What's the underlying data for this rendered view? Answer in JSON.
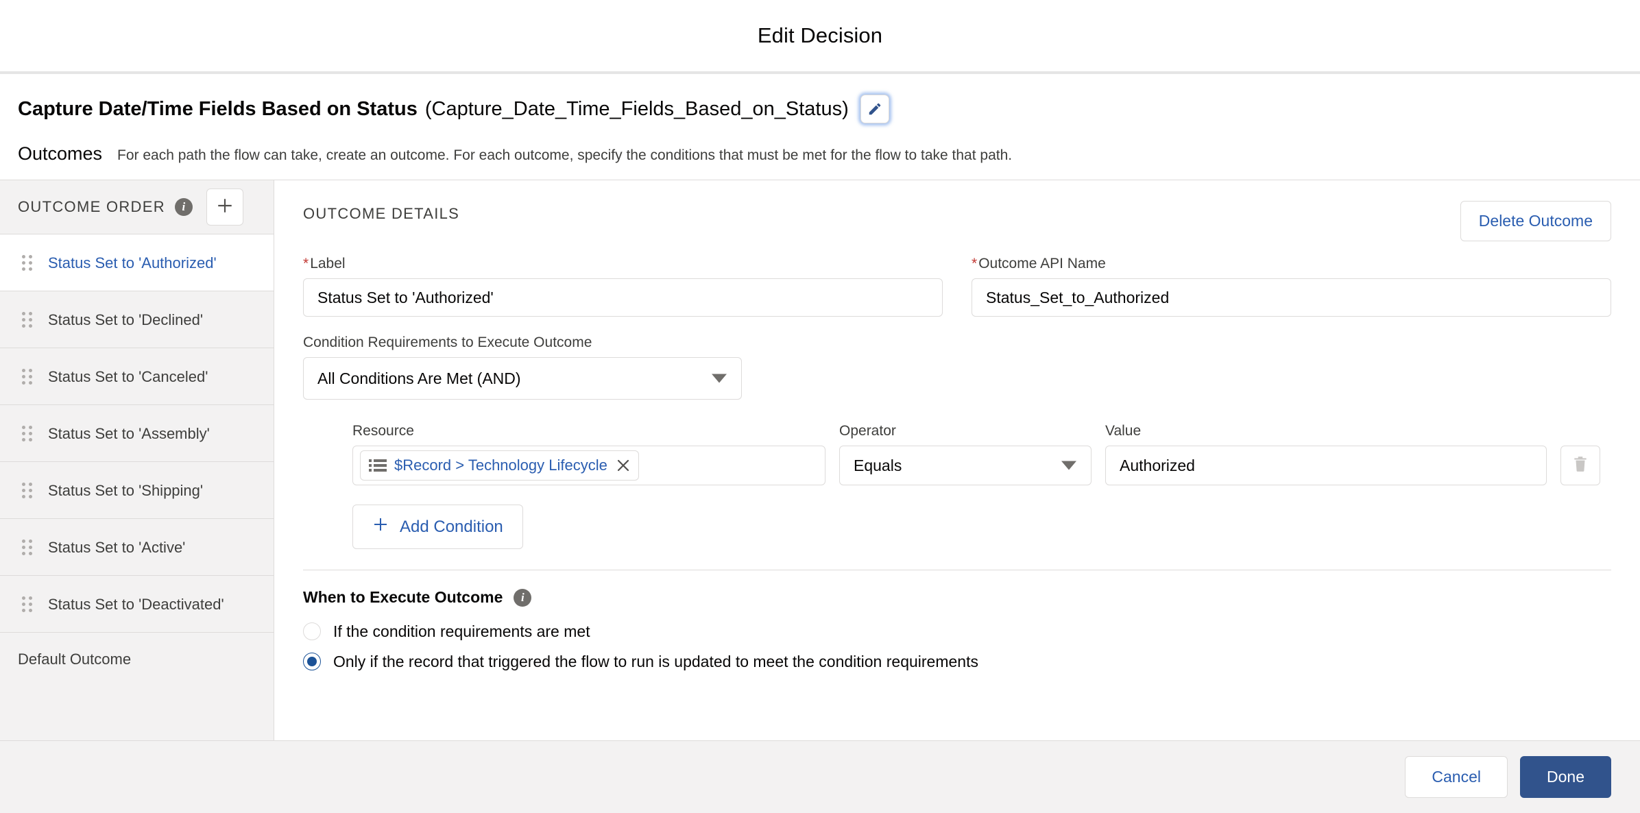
{
  "modal": {
    "title": "Edit Decision"
  },
  "element": {
    "label": "Capture Date/Time Fields Based on Status",
    "api_name": "(Capture_Date_Time_Fields_Based_on_Status)",
    "edit_icon": "pencil-icon"
  },
  "outcomes_intro": {
    "heading": "Outcomes",
    "description": "For each path the flow can take, create an outcome. For each outcome, specify the conditions that must be met for the flow to take that path."
  },
  "sidebar": {
    "header_title": "OUTCOME ORDER",
    "info_icon": "info-icon",
    "add_icon": "plus-icon",
    "items": [
      {
        "label": "Status Set to 'Authorized'",
        "selected": true
      },
      {
        "label": "Status Set to 'Declined'",
        "selected": false
      },
      {
        "label": "Status Set to 'Canceled'",
        "selected": false
      },
      {
        "label": "Status Set to 'Assembly'",
        "selected": false
      },
      {
        "label": "Status Set to 'Shipping'",
        "selected": false
      },
      {
        "label": "Status Set to 'Active'",
        "selected": false
      },
      {
        "label": "Status Set to 'Deactivated'",
        "selected": false
      }
    ],
    "default_outcome": "Default Outcome"
  },
  "details": {
    "heading": "OUTCOME DETAILS",
    "delete_outcome_label": "Delete Outcome",
    "label_field": {
      "label": "Label",
      "required_marker": "*",
      "value": "Status Set to 'Authorized'"
    },
    "api_name_field": {
      "label": "Outcome API Name",
      "required_marker": "*",
      "value": "Status_Set_to_Authorized"
    },
    "condition_requirements": {
      "label": "Condition Requirements to Execute Outcome",
      "value": "All Conditions Are Met (AND)",
      "caret_icon": "chevron-down-icon"
    },
    "condition_headers": {
      "resource": "Resource",
      "operator": "Operator",
      "value": "Value"
    },
    "condition_row": {
      "resource_icon": "list-icon",
      "resource_pill": "$Record > Technology Lifecycle",
      "resource_remove_icon": "close-icon",
      "operator": "Equals",
      "operator_caret_icon": "chevron-down-icon",
      "value": "Authorized",
      "delete_icon": "trash-icon"
    },
    "add_condition_label": "Add Condition",
    "add_condition_icon": "plus-icon",
    "when_to_execute": {
      "title": "When to Execute Outcome",
      "info_icon": "info-icon",
      "options": [
        {
          "label": "If the condition requirements are met",
          "selected": false
        },
        {
          "label": "Only if the record that triggered the flow to run is updated to meet the condition requirements",
          "selected": true
        }
      ]
    }
  },
  "footer": {
    "cancel_label": "Cancel",
    "done_label": "Done"
  },
  "colors": {
    "brand_blue": "#31538c",
    "link_blue": "#2a5db0",
    "required_red": "#c23934",
    "border_grey": "#dddbda",
    "sidebar_bg": "#f3f2f2"
  }
}
